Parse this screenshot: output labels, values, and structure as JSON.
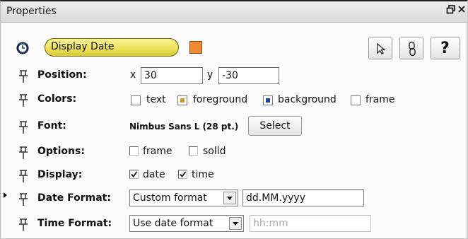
{
  "title": "Properties",
  "header": {
    "element_name": "Display Date",
    "element_color": "#f08a32"
  },
  "rows": {
    "position": {
      "label": "Position:",
      "x_label": "x",
      "x_value": "30",
      "y_label": "y",
      "y_value": "-30"
    },
    "colors": {
      "label": "Colors:",
      "text": "text",
      "foreground": "foreground",
      "background": "background",
      "frame": "frame",
      "foreground_color": "#d39a2a",
      "background_color": "#1f3fa0"
    },
    "font": {
      "label": "Font:",
      "value": "Nimbus Sans L (28 pt.)",
      "select": "Select"
    },
    "options": {
      "label": "Options:",
      "frame": "frame",
      "solid": "solid",
      "frame_checked": false,
      "solid_checked": false
    },
    "display": {
      "label": "Display:",
      "date": "date",
      "time": "time",
      "date_checked": true,
      "time_checked": true
    },
    "date_format": {
      "label": "Date Format:",
      "combo": "Custom format",
      "value": "dd.MM.yyyy"
    },
    "time_format": {
      "label": "Time Format:",
      "combo": "Use date format",
      "placeholder": "hh:mm"
    }
  },
  "icons": [
    "time-icon",
    "pointer-icon",
    "link-icon",
    "help-icon",
    "pin-icon",
    "float-icon",
    "close-icon",
    "dropdown-arrow-icon"
  ]
}
